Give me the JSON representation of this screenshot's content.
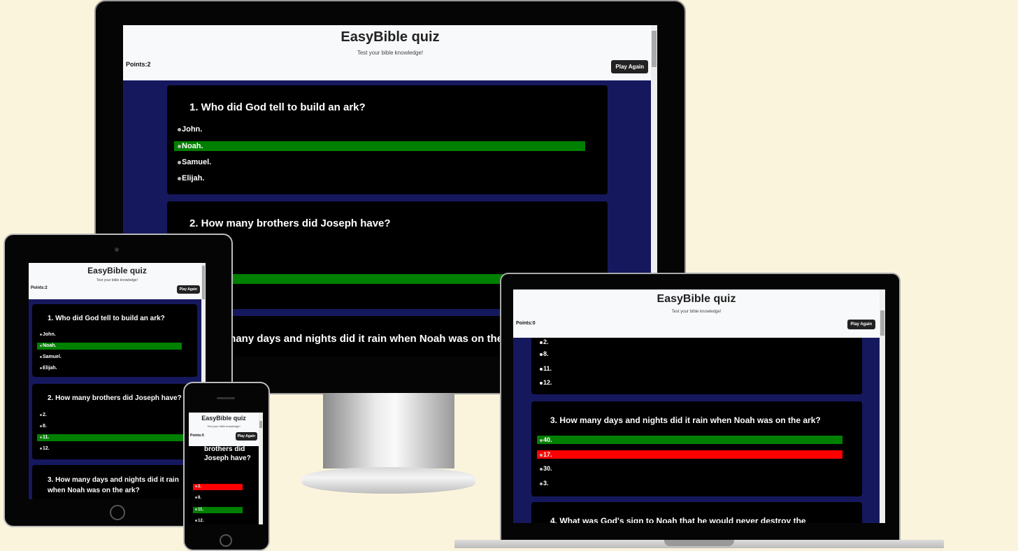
{
  "quiz": {
    "title": "EasyBible quiz",
    "subtitle": "Test your bible knowledge!",
    "play_again": "Play Again",
    "points_desktop": "Points:2",
    "points_tablet": "Points:2",
    "points_laptop": "Points:0",
    "points_phone": "Points:0"
  },
  "questions": {
    "q1": "1. Who did God tell to build an ark?",
    "q1_options": [
      "John.",
      "Noah.",
      "Samuel.",
      "Elijah."
    ],
    "q2": "2. How many brothers did Joseph have?",
    "q2_options": [
      "2.",
      "8.",
      "11.",
      "12."
    ],
    "q3": "3. How many days and nights did it rain when Noah was on the ark?",
    "q3_fragment": "many days and nights did it rain when Noah was on the",
    "q3_options": [
      "40.",
      "17.",
      "30.",
      "3."
    ],
    "q4": "4. What was God's sign to Noah that he would never destroy the",
    "phone_q2_fragment": "brothers did Joseph have?"
  },
  "colors": {
    "correct": "#008000",
    "wrong": "#ff0000",
    "quiz_bg": "#16185e",
    "page_bg": "#fbf4dc"
  }
}
